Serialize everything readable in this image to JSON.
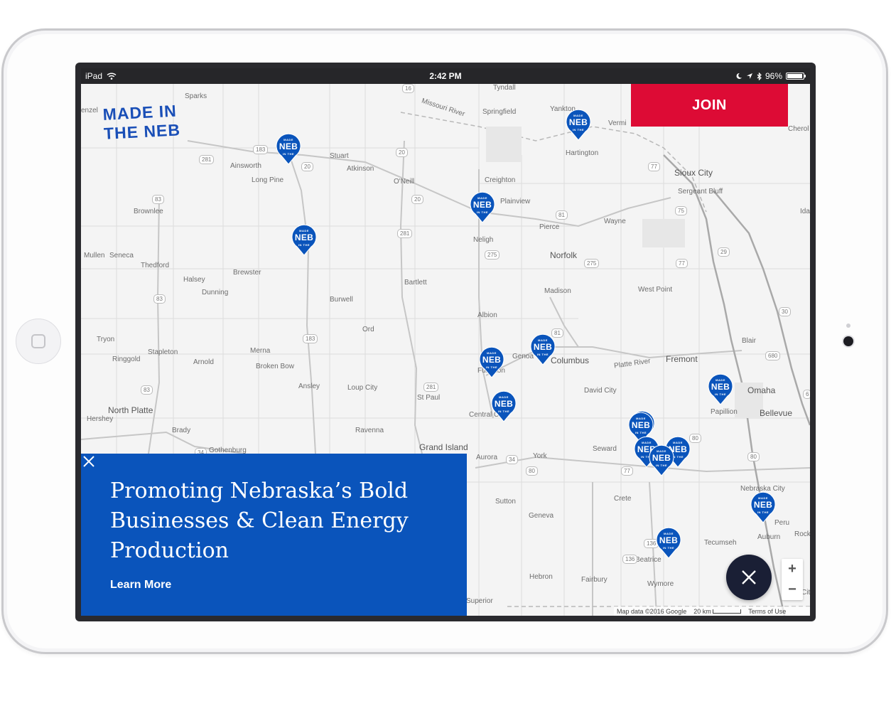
{
  "status_bar": {
    "device": "iPad",
    "time": "2:42 PM",
    "battery": "96%",
    "battery_level": 0.96
  },
  "brand": {
    "line1": "MADE IN",
    "line2": "THE NEB",
    "color": "#1a4fb7"
  },
  "join_button": {
    "label": "JOIN",
    "color": "#dd0b35"
  },
  "promo": {
    "headline": "Promoting Nebraska’s Bold Businesses & Clean Energy Production",
    "link_label": "Learn More",
    "color": "#0a54bb"
  },
  "map": {
    "attribution": "Map data ©2016 Google",
    "scale": "20 km",
    "terms": "Terms of Use",
    "zoom_in": "+",
    "zoom_out": "−",
    "pin_text": {
      "top": "MADE",
      "main": "NEB",
      "bottom": "IN THE"
    },
    "places": [
      "Sparks",
      "Tyndall",
      "Yankton",
      "Springfield",
      "Vermi",
      "Cherol",
      "Stuart",
      "Atkinson",
      "Ainsworth",
      "Long Pine",
      "O'Neill",
      "Creighton",
      "Hartington",
      "Sioux City",
      "Sergeant Bluff",
      "Plainview",
      "Pierce",
      "Wayne",
      "Brownlee",
      "Neligh",
      "Norfolk",
      "Mullen",
      "Seneca",
      "Thedford",
      "Brewster",
      "Halsey",
      "Dunning",
      "Bartlett",
      "Madison",
      "West Point",
      "Burwell",
      "Albion",
      "Tryon",
      "Stapleton",
      "Ringgold",
      "Merna",
      "Arnold",
      "Broken Bow",
      "Ord",
      "Genoa",
      "Columbus",
      "Fremont",
      "Blair",
      "Ansley",
      "Loup City",
      "St Paul",
      "Fullerton",
      "David City",
      "Omaha",
      "Papillion",
      "Bellevue",
      "North Platte",
      "Hershey",
      "Central City",
      "Brady",
      "Ravenna",
      "Grand Island",
      "Aurora",
      "York",
      "Seward",
      "Gothenburg",
      "Nebraska City",
      "Crete",
      "Sutton",
      "Geneva",
      "Peru",
      "Auburn",
      "Tecumseh",
      "Beatrice",
      "Hebron",
      "Fairbury",
      "Wymore",
      "Superior",
      "Ida",
      "Rock",
      "Cit",
      "enzel",
      "Platte River",
      "Missouri River"
    ],
    "highways": [
      "16",
      "183",
      "20",
      "281",
      "20",
      "83",
      "20",
      "81",
      "77",
      "75",
      "29",
      "281",
      "275",
      "275",
      "83",
      "77",
      "30",
      "183",
      "81",
      "83",
      "281",
      "680",
      "6",
      "80",
      "34",
      "34",
      "80",
      "80",
      "77",
      "136",
      "136"
    ]
  }
}
